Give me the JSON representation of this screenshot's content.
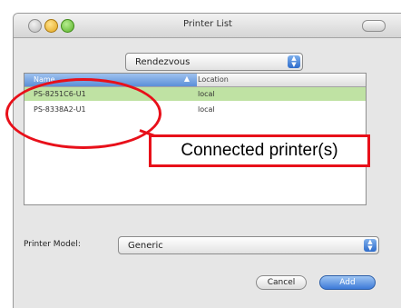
{
  "window": {
    "title": "Printer List"
  },
  "source_popup": {
    "value": "Rendezvous"
  },
  "list": {
    "columns": [
      "Name",
      "Location"
    ],
    "rows": [
      {
        "name": "PS-8251C6-U1",
        "location": "local",
        "selected": true
      },
      {
        "name": "PS-8338A2-U1",
        "location": "local",
        "selected": false
      }
    ]
  },
  "annotation": {
    "text": "Connected printer(s)",
    "color": "#e8101a"
  },
  "printer_model": {
    "label": "Printer Model:",
    "value": "Generic"
  },
  "buttons": {
    "cancel": "Cancel",
    "add": "Add"
  },
  "icons": [
    "close-icon",
    "minimize-icon",
    "zoom-icon",
    "toolbar-toggle-icon",
    "popup-arrows-icon",
    "sort-arrow-icon"
  ]
}
